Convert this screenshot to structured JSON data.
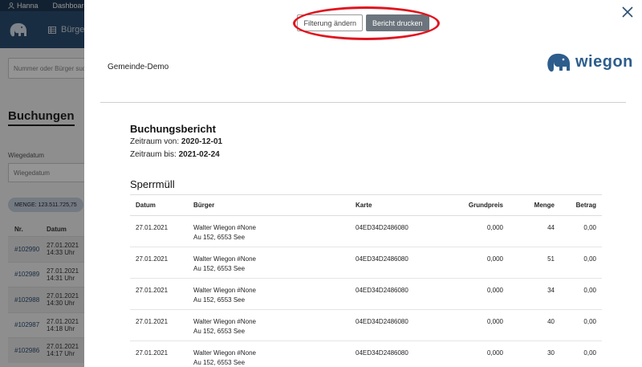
{
  "background": {
    "topnav": {
      "user": "Hanna",
      "dashboard": "Dashboard"
    },
    "subnav": {
      "menu_label": "Bürger"
    },
    "search_placeholder": "Nummer oder Bürger such",
    "page_title": "Buchungen",
    "wiegedatum_label": "Wiegedatum",
    "wiegedatum_placeholder": "Wiegedatum",
    "menge_badge": "MENGE: 123.511.725,75",
    "table": {
      "headers": [
        "Nr.",
        "Datum"
      ],
      "rows": [
        {
          "nr": "#102990",
          "date": "27.01.2021",
          "time": "14:33 Uhr"
        },
        {
          "nr": "#102989",
          "date": "27.01.2021",
          "time": "14:31 Uhr"
        },
        {
          "nr": "#102988",
          "date": "27.01.2021",
          "time": "14:30 Uhr"
        },
        {
          "nr": "#102987",
          "date": "27.01.2021",
          "time": "14:18 Uhr"
        },
        {
          "nr": "#102986",
          "date": "27.01.2021",
          "time": "14:17 Uhr"
        }
      ]
    }
  },
  "modal": {
    "toolbar": {
      "filter_label": "Filterung ändern",
      "print_label": "Bericht drucken"
    },
    "org_name": "Gemeinde-Demo",
    "brand_name": "wiegon",
    "report": {
      "title": "Buchungsbericht",
      "from_label": "Zeitraum von:",
      "from_value": "2020-12-01",
      "to_label": "Zeitraum bis:",
      "to_value": "2021-02-24",
      "section": "Sperrmüll",
      "columns": [
        "Datum",
        "Bürger",
        "Karte",
        "Grundpreis",
        "Menge",
        "Betrag"
      ],
      "rows": [
        {
          "date": "27.01.2021",
          "citizen": "Walter Wiegon #None",
          "address": "Au 152, 6553 See",
          "card": "04ED34D2486080",
          "base": "0,000",
          "qty": "44",
          "amount": "0,00"
        },
        {
          "date": "27.01.2021",
          "citizen": "Walter Wiegon #None",
          "address": "Au 152, 6553 See",
          "card": "04ED34D2486080",
          "base": "0,000",
          "qty": "51",
          "amount": "0,00"
        },
        {
          "date": "27.01.2021",
          "citizen": "Walter Wiegon #None",
          "address": "Au 152, 6553 See",
          "card": "04ED34D2486080",
          "base": "0,000",
          "qty": "34",
          "amount": "0,00"
        },
        {
          "date": "27.01.2021",
          "citizen": "Walter Wiegon #None",
          "address": "Au 152, 6553 See",
          "card": "04ED34D2486080",
          "base": "0,000",
          "qty": "40",
          "amount": "0,00"
        },
        {
          "date": "27.01.2021",
          "citizen": "Walter Wiegon #None",
          "address": "Au 152, 6553 See",
          "card": "04ED34D2486080",
          "base": "0,000",
          "qty": "30",
          "amount": "0,00"
        }
      ]
    }
  },
  "icons": {
    "user": "user-icon",
    "elephant": "elephant-logo-icon",
    "grid": "grid-icon",
    "close": "close-icon"
  },
  "colors": {
    "nav_dark": "#203a55",
    "nav": "#2c4e73",
    "brand": "#2d5d8c",
    "highlight": "#e0141e",
    "print_button": "#6c757d"
  }
}
